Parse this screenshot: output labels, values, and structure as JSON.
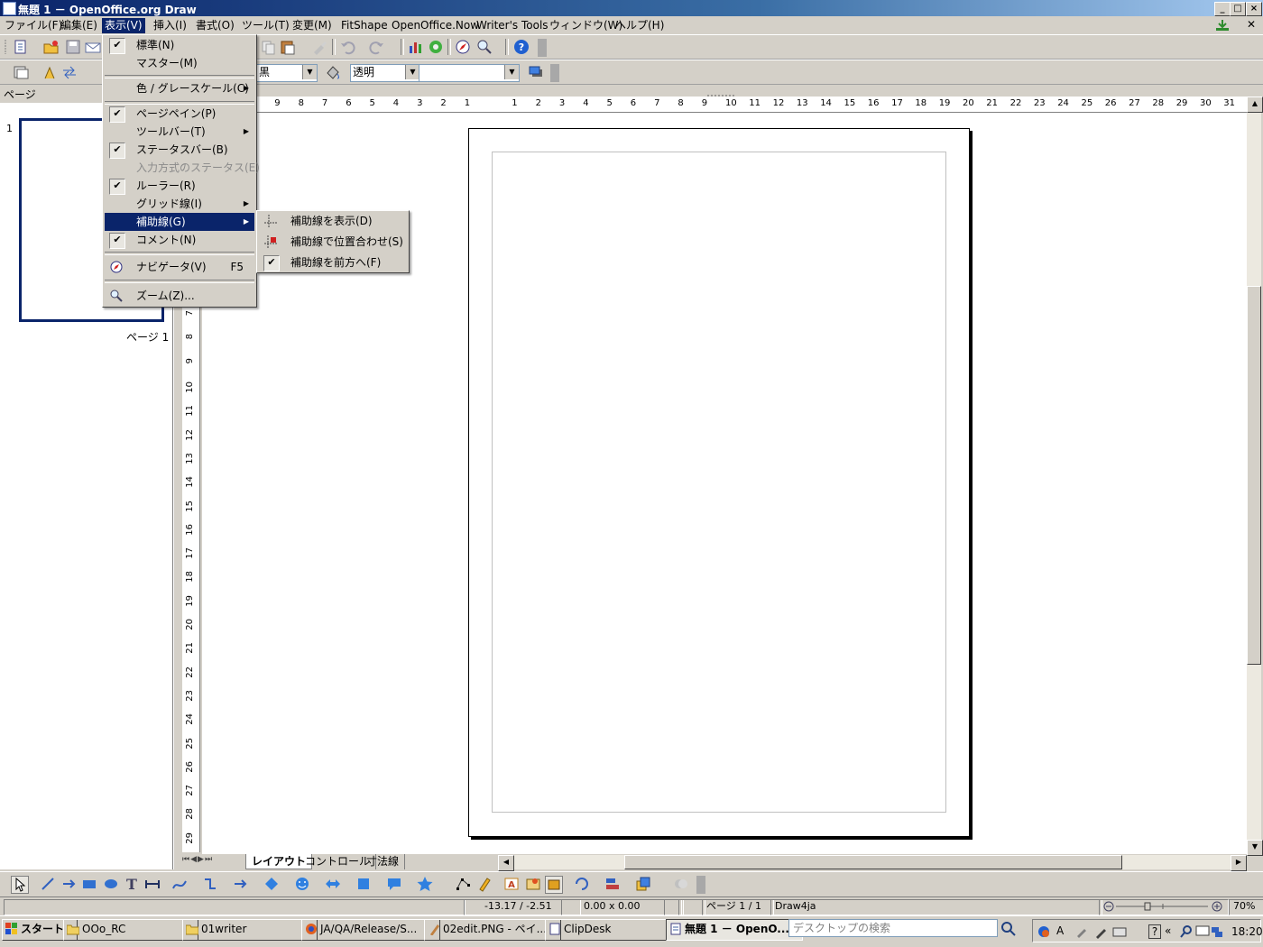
{
  "window": {
    "title": "無題 1 － OpenOffice.org  Draw"
  },
  "menubar": {
    "items": [
      {
        "label": "ファイル(F)"
      },
      {
        "label": "編集(E)"
      },
      {
        "label": "表示(V)"
      },
      {
        "label": "挿入(I)"
      },
      {
        "label": "書式(O)"
      },
      {
        "label": "ツール(T)"
      },
      {
        "label": "変更(M)"
      },
      {
        "label": "FitShape"
      },
      {
        "label": "OpenOffice.Now"
      },
      {
        "label": "Writer's Tools"
      },
      {
        "label": "ウィンドウ(W)"
      },
      {
        "label": "ヘルプ(H)"
      }
    ]
  },
  "line_toolbar": {
    "line_color": "黒",
    "area_style": "透明",
    "area_value": ""
  },
  "pages_pane": {
    "header": "ページ",
    "page_number": "1",
    "page_caption": "ページ 1"
  },
  "view_menu": {
    "items": [
      {
        "label": "標準(N)",
        "checked": true
      },
      {
        "label": "マスター(M)",
        "checked": false
      },
      {
        "label": "色 / グレースケール(C)",
        "submenu": true
      },
      {
        "label": "ページペイン(P)",
        "checked": true
      },
      {
        "label": "ツールバー(T)",
        "submenu": true
      },
      {
        "label": "ステータスバー(B)",
        "checked": true
      },
      {
        "label": "入力方式のステータス(E)",
        "disabled": true
      },
      {
        "label": "ルーラー(R)",
        "checked": true
      },
      {
        "label": "グリッド線(I)",
        "submenu": true
      },
      {
        "label": "補助線(G)",
        "submenu": true,
        "highlighted": true
      },
      {
        "label": "コメント(N)",
        "checked": true
      },
      {
        "label": "ナビゲータ(V)",
        "shortcut": "F5"
      },
      {
        "label": "ズーム(Z)..."
      }
    ]
  },
  "guides_submenu": {
    "items": [
      {
        "label": "補助線を表示(D)"
      },
      {
        "label": "補助線で位置合わせ(S)"
      },
      {
        "label": "補助線を前方へ(F)",
        "checked": true
      }
    ]
  },
  "ruler": {
    "h_ticks": [
      "9",
      "8",
      "7",
      "6",
      "5",
      "4",
      "3",
      "2",
      "1",
      "1",
      "2",
      "3",
      "4",
      "5",
      "6",
      "7",
      "8",
      "9",
      "10",
      "11",
      "12",
      "13",
      "14",
      "15",
      "16",
      "17",
      "18",
      "19",
      "20",
      "21",
      "22",
      "23",
      "24",
      "25",
      "26",
      "27",
      "28",
      "29",
      "30",
      "31"
    ],
    "v_ticks": [
      "7",
      "8",
      "9",
      "10",
      "11",
      "12",
      "13",
      "14",
      "15",
      "16",
      "17",
      "18",
      "19",
      "20",
      "21",
      "22",
      "23",
      "24",
      "25",
      "26",
      "27",
      "28",
      "29"
    ]
  },
  "layer_tabs": [
    "レイアウト",
    "コントロール",
    "寸法線"
  ],
  "statusbar": {
    "position": "-13.17 / -2.51",
    "size": "0.00 x 0.00",
    "page": "ページ 1 / 1",
    "style": "Draw4ja",
    "zoom": "70%"
  },
  "taskbar": {
    "start": "スタート",
    "tasks": [
      {
        "label": "OOo_RC"
      },
      {
        "label": "01writer"
      },
      {
        "label": "JA/QA/Release/S..."
      },
      {
        "label": "02edit.PNG - ペイ..."
      },
      {
        "label": "ClipDesk"
      },
      {
        "label": "無題 1 － OpenO..."
      }
    ],
    "search_placeholder": "デスクトップの検索",
    "clock": "18:20"
  }
}
